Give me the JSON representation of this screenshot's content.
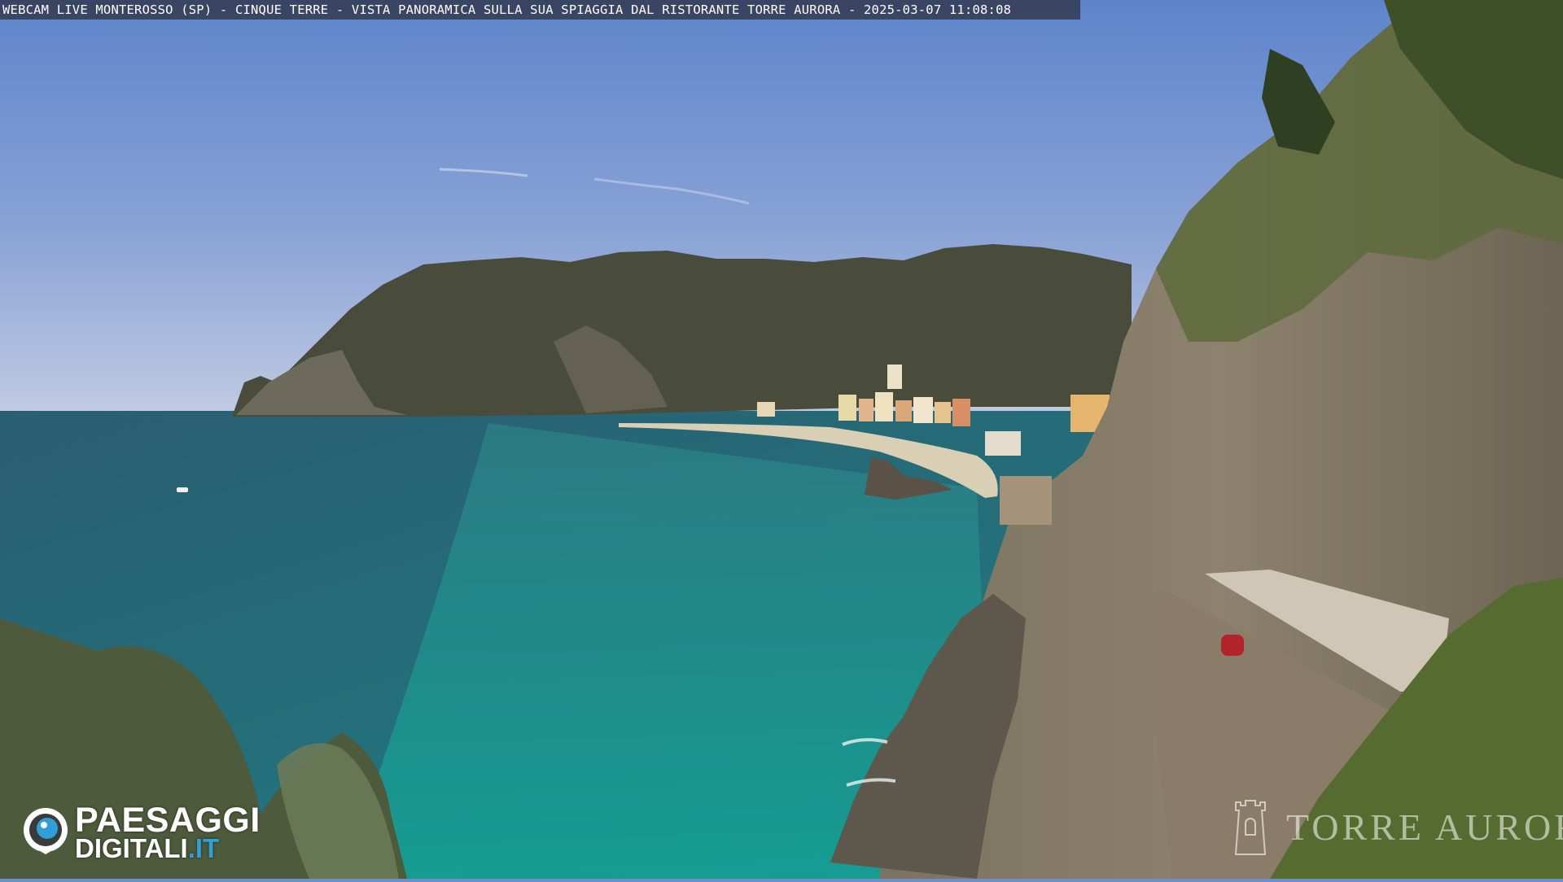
{
  "webcam": {
    "caption": "WEBCAM LIVE MONTEROSSO (SP) - CINQUE TERRE - VISTA PANORAMICA SULLA SUA SPIAGGIA DAL RISTORANTE TORRE AURORA - 2025-03-07 11:08:08"
  },
  "logo": {
    "line1": "PAESAGGI",
    "line2_main": "DIGITALI",
    "line2_tld": ".IT",
    "icon": "eye-icon"
  },
  "watermark": {
    "text": "TORRE AURORA",
    "icon": "tower-icon"
  },
  "colors": {
    "sky_top": "#5c82c9",
    "sky_horizon": "#bcc9e4",
    "sea_deep": "#1f5f6e",
    "sea_shallow": "#2a9a93",
    "headland": "#4a4d3a",
    "cliff": "#7a6f5e",
    "beach": "#d8cdb2",
    "logo_accent": "#2f9fd8"
  }
}
